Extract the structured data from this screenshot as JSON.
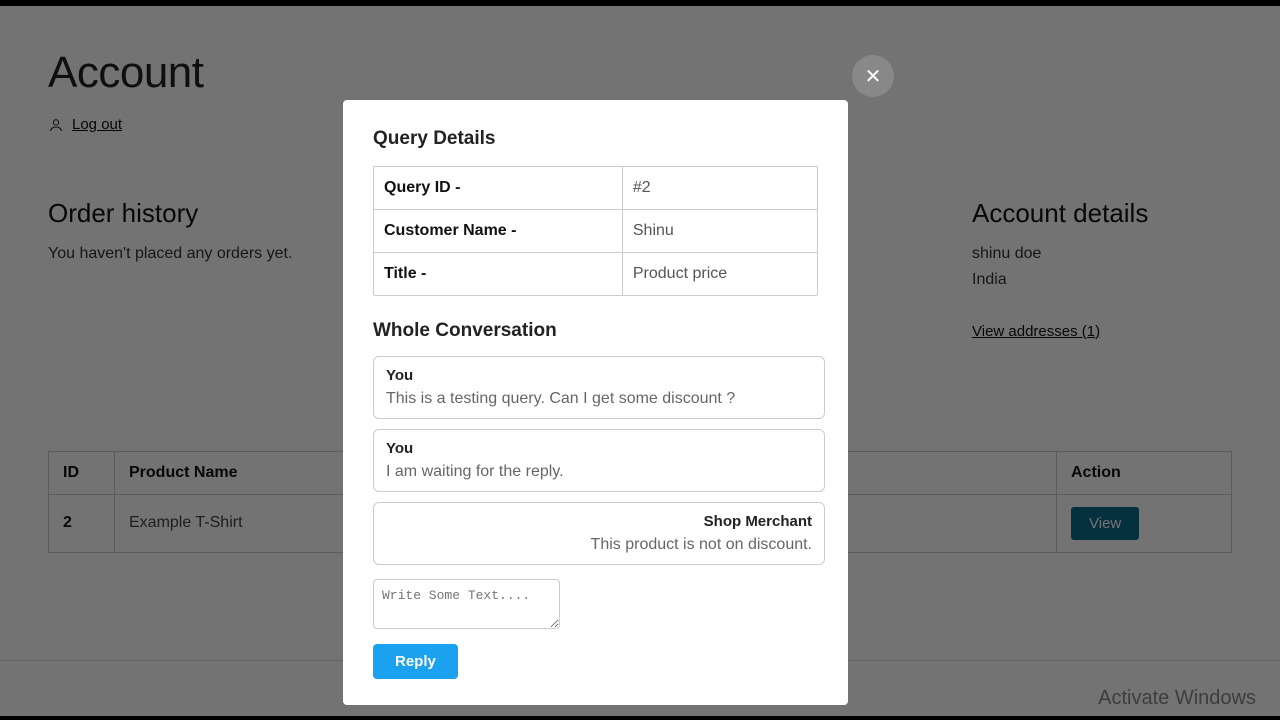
{
  "page": {
    "title": "Account",
    "logout_label": "Log out"
  },
  "order_history": {
    "heading": "Order history",
    "empty_text": "You haven't placed any orders yet."
  },
  "account_details": {
    "heading": "Account details",
    "name": "shinu doe",
    "country": "India",
    "view_addresses": "View addresses (1)"
  },
  "orders_table": {
    "headers": {
      "id": "ID",
      "product": "Product Name",
      "action": "Action"
    },
    "rows": [
      {
        "id": "2",
        "product": "Example T-Shirt",
        "action_label": "View"
      }
    ]
  },
  "modal": {
    "title": "Query Details",
    "fields": {
      "query_id_label": "Query ID -",
      "query_id_value": "#2",
      "customer_label": "Customer Name -",
      "customer_value": "Shinu",
      "title_label": "Title -",
      "title_value": "Product price"
    },
    "conversation_heading": "Whole Conversation",
    "messages": [
      {
        "who": "You",
        "body": "This is a testing query. Can I get some discount ?",
        "mine": true
      },
      {
        "who": "You",
        "body": "I am waiting for the reply.",
        "mine": true
      },
      {
        "who": "Shop Merchant",
        "body": "This product is not on discount.",
        "mine": false
      }
    ],
    "reply_placeholder": "Write Some Text....",
    "reply_button": "Reply",
    "close_icon": "✕"
  },
  "watermark": "Activate Windows"
}
